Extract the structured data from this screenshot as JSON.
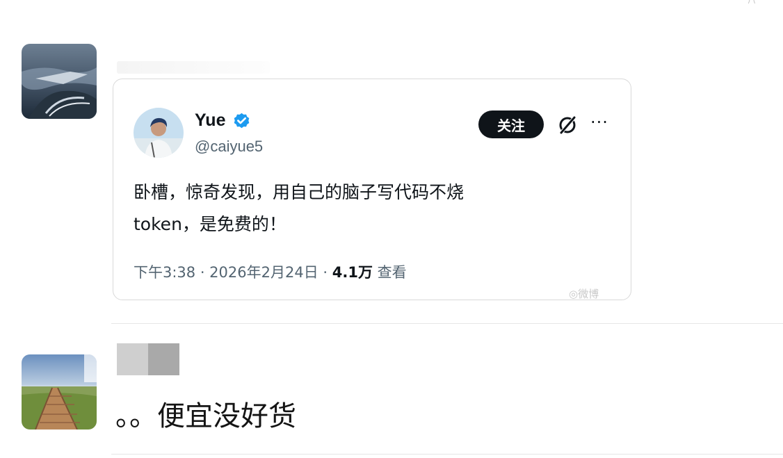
{
  "top_corner": {
    "mark": "/ \\"
  },
  "comment_1": {
    "tweet": {
      "display_name": "Yue",
      "handle": "@caiyue5",
      "follow_label": "关注",
      "more_label": "···",
      "text_line_1": "卧槽，惊奇发现，用自己的脑子写代码不烧",
      "text_line_2": "token，是免费的！",
      "time": "下午3:38 · 2026年2月24日 · ",
      "views": "4.1万",
      "views_label": " 查看",
      "watermark": "微博"
    }
  },
  "comment_2": {
    "text": "。。便宜没好货"
  },
  "icons": {
    "verified": "verified-badge-icon",
    "grok": "grok-icon",
    "more": "more-icon"
  },
  "colors": {
    "verified_blue": "#1d9bf0",
    "follow_bg": "#0f1419",
    "secondary_text": "#536471"
  }
}
